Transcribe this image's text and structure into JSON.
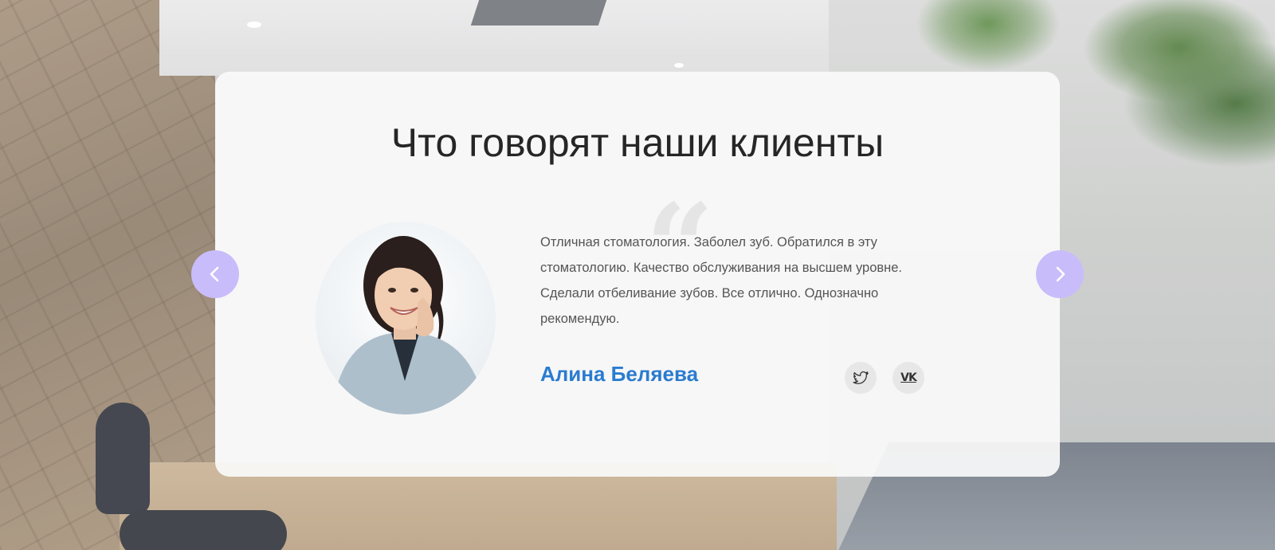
{
  "section": {
    "title": "Что говорят наши клиенты"
  },
  "testimonial": {
    "text": "Отличная стоматология. Заболел зуб. Обратился в эту стоматологию. Качество обслуживания на высшем уровне. Сделали отбеливание зубов. Все отлично. Однозначно рекомендую.",
    "author": "Алина Беляева",
    "quote_glyph": "“"
  },
  "social": {
    "twitter_icon": "twitter-bird-icon",
    "vk_label": "VK"
  },
  "controls": {
    "prev_icon": "chevron-left-icon",
    "next_icon": "chevron-right-icon"
  },
  "colors": {
    "accent": "#2a7bd0",
    "nav_button": "#c9bcfb",
    "card_bg": "#fafafa"
  }
}
